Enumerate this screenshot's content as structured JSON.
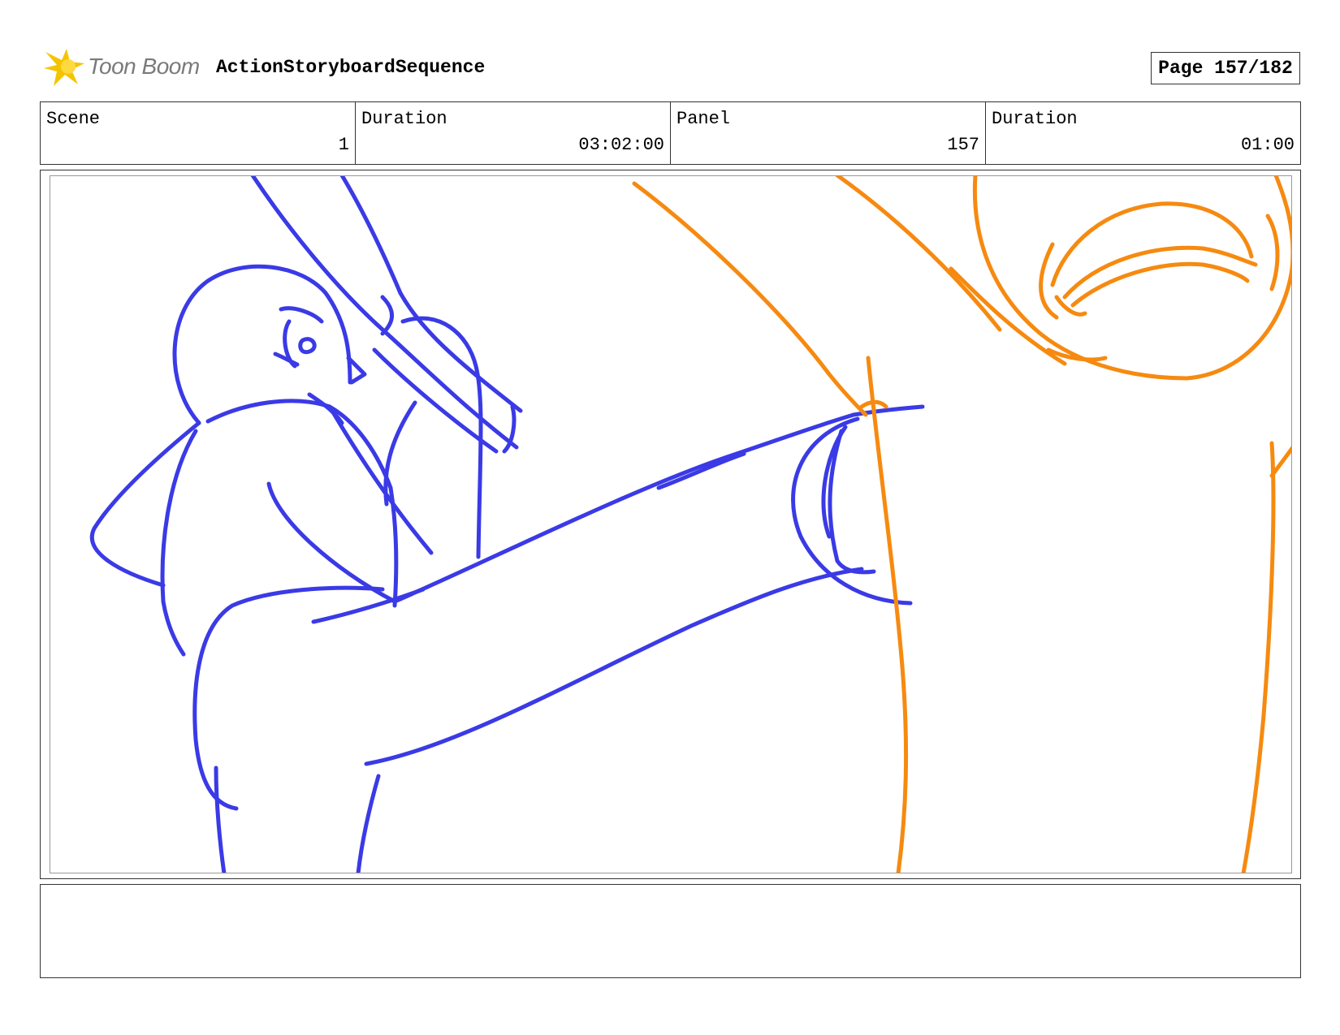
{
  "header": {
    "logo_text": "Toon Boom",
    "sequence_title": "ActionStoryboardSequence",
    "page_label": "Page 157/182"
  },
  "info": {
    "scene_label": "Scene",
    "scene_value": "1",
    "scene_duration_label": "Duration",
    "scene_duration_value": "03:02:00",
    "panel_label": "Panel",
    "panel_value": "157",
    "panel_duration_label": "Duration",
    "panel_duration_value": "01:00"
  },
  "colors": {
    "character_a": "#3a3ae6",
    "character_b": "#f68a10",
    "logo_star": "#f5c400"
  },
  "notes": {
    "text": ""
  }
}
